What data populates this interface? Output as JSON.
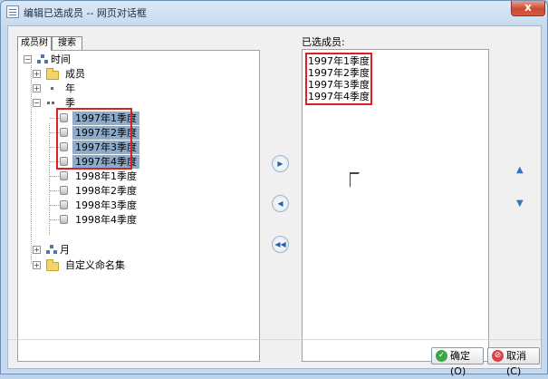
{
  "window": {
    "title": "编辑已选成员 -- 网页对话框",
    "close_label": "x"
  },
  "tabs": [
    {
      "label": "成员树",
      "active": true
    },
    {
      "label": "搜索",
      "active": false
    }
  ],
  "tree": {
    "root": "时间",
    "nodes": [
      "成员",
      "年",
      "季",
      "月",
      "自定义命名集"
    ],
    "quarter_members": [
      "1997年1季度",
      "1997年2季度",
      "1997年3季度",
      "1997年4季度",
      "1998年1季度",
      "1998年2季度",
      "1998年3季度",
      "1998年4季度"
    ]
  },
  "move_buttons": {
    "add": "▶",
    "remove": "◀",
    "remove_all": "◀◀"
  },
  "selected": {
    "label": "已选成员:",
    "items": [
      "1997年1季度",
      "1997年2季度",
      "1997年3季度",
      "1997年4季度"
    ]
  },
  "order": {
    "up": "▲",
    "down": "▼"
  },
  "footer": {
    "ok_label": "确定(O)",
    "cancel_label": "取消(C)"
  },
  "colors": {
    "selection": "#8eadcd",
    "highlight_box": "#e02020",
    "accent": "#2b62ad"
  }
}
